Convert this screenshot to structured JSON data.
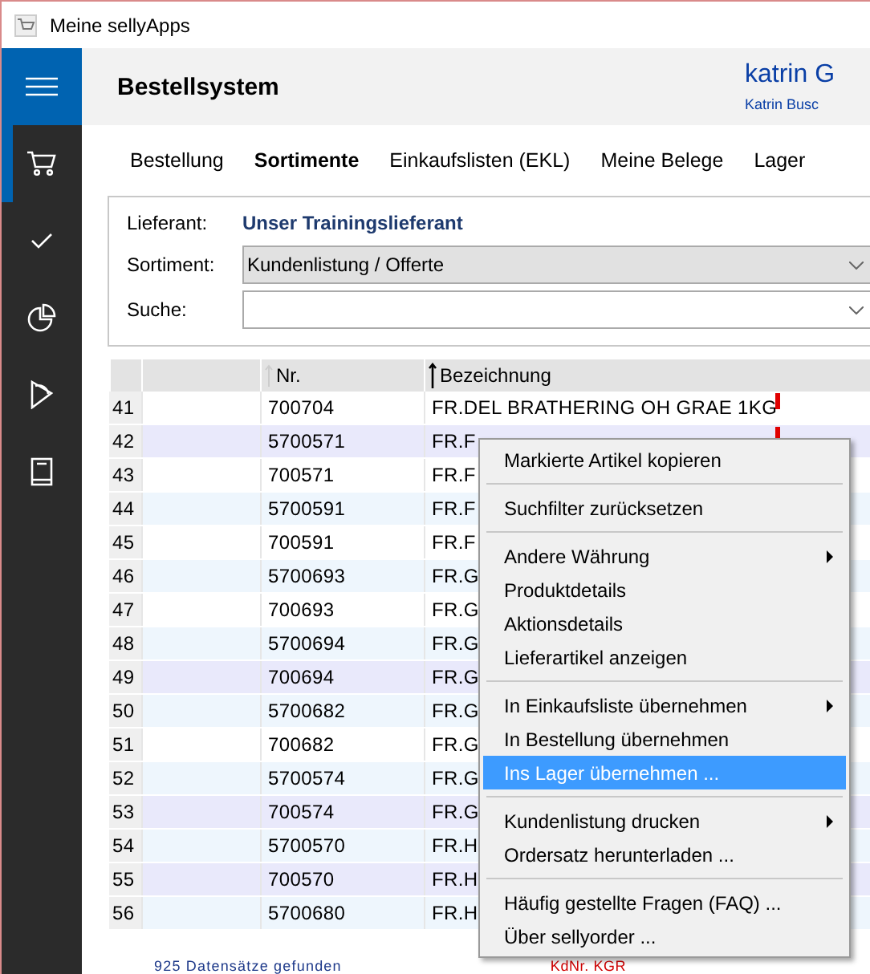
{
  "window": {
    "title": "Meine sellyApps"
  },
  "nav": [
    {
      "kind": "cart",
      "selected": true
    },
    {
      "kind": "check",
      "selected": false
    },
    {
      "kind": "pie",
      "selected": false
    },
    {
      "kind": "tag",
      "selected": false
    },
    {
      "kind": "book",
      "selected": false
    }
  ],
  "header": {
    "title": "Bestellsystem",
    "user_name": "katrin G",
    "user_detail": "Katrin Busc"
  },
  "tabs": [
    {
      "label": "Bestellung",
      "selected": false
    },
    {
      "label": "Sortimente",
      "selected": true
    },
    {
      "label": "Einkaufslisten (EKL)",
      "selected": false
    },
    {
      "label": "Meine Belege",
      "selected": false
    },
    {
      "label": "Lager",
      "selected": false
    }
  ],
  "filters": {
    "supplier_label": "Lieferant:",
    "supplier": "Unser Trainingslieferant",
    "range_label": "Sortiment:",
    "range": "Kundenlistung / Offerte",
    "search_label": "Suche:"
  },
  "table": {
    "columns": [
      "Nr.",
      "Bezeichnung"
    ],
    "rows": [
      {
        "index": "41",
        "nr": "700704",
        "name": "FR.DEL BRATHERING OH GRAE 1KG",
        "flag": true,
        "selected": false
      },
      {
        "index": "42",
        "nr": "5700571",
        "name": "FR.F",
        "flag": true,
        "selected": true
      },
      {
        "index": "43",
        "nr": "700571",
        "name": "FR.F",
        "selected": false
      },
      {
        "index": "44",
        "nr": "5700591",
        "name": "FR.F",
        "selected": false
      },
      {
        "index": "45",
        "nr": "700591",
        "name": "FR.F",
        "selected": false
      },
      {
        "index": "46",
        "nr": "5700693",
        "name": "FR.G",
        "selected": false
      },
      {
        "index": "47",
        "nr": "700693",
        "name": "FR.G",
        "selected": false
      },
      {
        "index": "48",
        "nr": "5700694",
        "name": "FR.G",
        "selected": false
      },
      {
        "index": "49",
        "nr": "700694",
        "name": "FR.G",
        "selected": true
      },
      {
        "index": "50",
        "nr": "5700682",
        "name": "FR.G",
        "selected": false
      },
      {
        "index": "51",
        "nr": "700682",
        "name": "FR.G",
        "selected": false
      },
      {
        "index": "52",
        "nr": "5700574",
        "name": "FR.G",
        "selected": false
      },
      {
        "index": "53",
        "nr": "700574",
        "name": "FR.G",
        "selected": true
      },
      {
        "index": "54",
        "nr": "5700570",
        "name": "FR.H",
        "selected": false
      },
      {
        "index": "55",
        "nr": "700570",
        "name": "FR.H",
        "selected": true
      },
      {
        "index": "56",
        "nr": "5700680",
        "name": "FR.H",
        "selected": false
      }
    ]
  },
  "status": {
    "count": "925 Datensätze gefunden",
    "customer": "KdNr. KGR"
  },
  "context_menu": {
    "groups": [
      [
        {
          "label": "Markierte Artikel kopieren",
          "submenu": false,
          "selected": false
        }
      ],
      [
        {
          "label": "Suchfilter zurücksetzen",
          "submenu": false,
          "selected": false
        }
      ],
      [
        {
          "label": "Andere Währung",
          "submenu": true,
          "selected": false
        },
        {
          "label": "Produktdetails",
          "submenu": false,
          "selected": false
        },
        {
          "label": "Aktionsdetails",
          "submenu": false,
          "selected": false
        },
        {
          "label": "Lieferartikel anzeigen",
          "submenu": false,
          "selected": false
        }
      ],
      [
        {
          "label": "In Einkaufsliste übernehmen",
          "submenu": true,
          "selected": false
        },
        {
          "label": "In Bestellung übernehmen",
          "submenu": false,
          "selected": false
        },
        {
          "label": "Ins Lager übernehmen ...",
          "submenu": false,
          "selected": true
        }
      ],
      [
        {
          "label": "Kundenlistung drucken",
          "submenu": true,
          "selected": false
        },
        {
          "label": "Ordersatz herunterladen ...",
          "submenu": false,
          "selected": false
        }
      ],
      [
        {
          "label": "Häufig gestellte Fragen (FAQ) ...",
          "submenu": false,
          "selected": false
        },
        {
          "label": "Über sellyorder ...",
          "submenu": false,
          "selected": false
        }
      ]
    ]
  }
}
